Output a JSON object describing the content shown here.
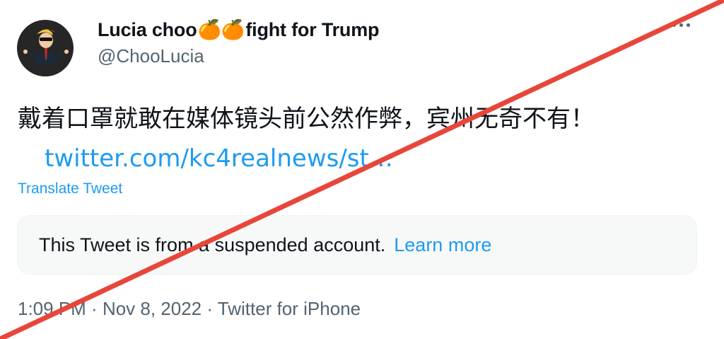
{
  "author": {
    "name_part1": "Lucia choo",
    "name_emoji": "🍊🍊",
    "name_part2": "fight for Trump",
    "handle": "@ChooLucia"
  },
  "tweet": {
    "text_line": "戴着口罩就敢在媒体镜头前公然作弊，宾州无奇不有！",
    "link_text": "twitter.com/kc4realnews/st…",
    "translate_label": "Translate Tweet"
  },
  "notice": {
    "text": "This Tweet is from a suspended account.",
    "learn_more": "Learn more"
  },
  "meta": {
    "time": "1:09 PM",
    "sep1": " · ",
    "date": "Nov 8, 2022",
    "sep2": " · ",
    "source": "Twitter for iPhone"
  },
  "colors": {
    "link": "#1d9bf0",
    "secondary": "#536471",
    "slash": "#e8463a"
  },
  "icons": {
    "avatar": "wsb-mascot-avatar",
    "more": "more-options-icon"
  }
}
